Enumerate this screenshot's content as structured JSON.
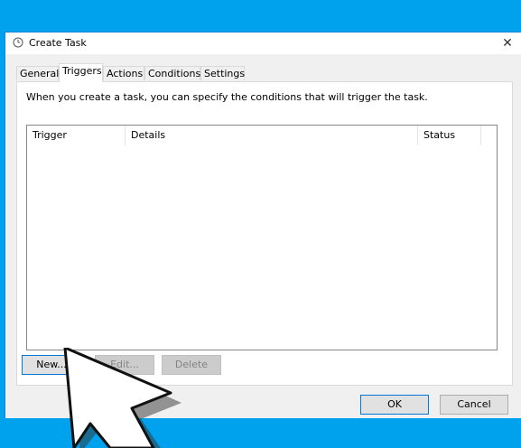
{
  "window": {
    "title": "Create Task",
    "close_glyph": "✕",
    "icon": "clock-icon"
  },
  "tabs": [
    {
      "label": "General"
    },
    {
      "label": "Triggers",
      "active": true
    },
    {
      "label": "Actions"
    },
    {
      "label": "Conditions"
    },
    {
      "label": "Settings"
    }
  ],
  "triggers_tab": {
    "description": "When you create a task, you can specify the conditions that will trigger the task.",
    "columns": [
      "Trigger",
      "Details",
      "Status"
    ],
    "rows": [],
    "buttons": {
      "new": "New...",
      "edit": "Edit...",
      "delete": "Delete"
    }
  },
  "footer": {
    "ok": "OK",
    "cancel": "Cancel"
  },
  "colors": {
    "desktop": "#00a2ed",
    "dialog_bg": "#f0f0f0",
    "accent": "#0078d7"
  }
}
